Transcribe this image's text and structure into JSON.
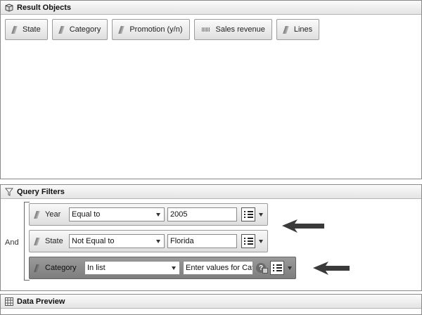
{
  "result_objects": {
    "title": "Result Objects",
    "items": [
      {
        "label": "State",
        "kind": "dimension"
      },
      {
        "label": "Category",
        "kind": "dimension"
      },
      {
        "label": "Promotion (y/n)",
        "kind": "dimension"
      },
      {
        "label": "Sales revenue",
        "kind": "measure"
      },
      {
        "label": "Lines",
        "kind": "dimension"
      }
    ]
  },
  "query_filters": {
    "title": "Query Filters",
    "operator_label": "And",
    "filters": [
      {
        "object": "Year",
        "operator": "Equal to",
        "value": "2005"
      },
      {
        "object": "State",
        "operator": "Not Equal to",
        "value": "Florida"
      },
      {
        "object": "Category",
        "operator": "In list",
        "value": "Enter values for Cat"
      }
    ]
  },
  "data_preview": {
    "title": "Data Preview"
  },
  "icons": {
    "result_objects": "cube-icon",
    "query_filters": "funnel-icon",
    "data_preview": "grid-icon"
  }
}
